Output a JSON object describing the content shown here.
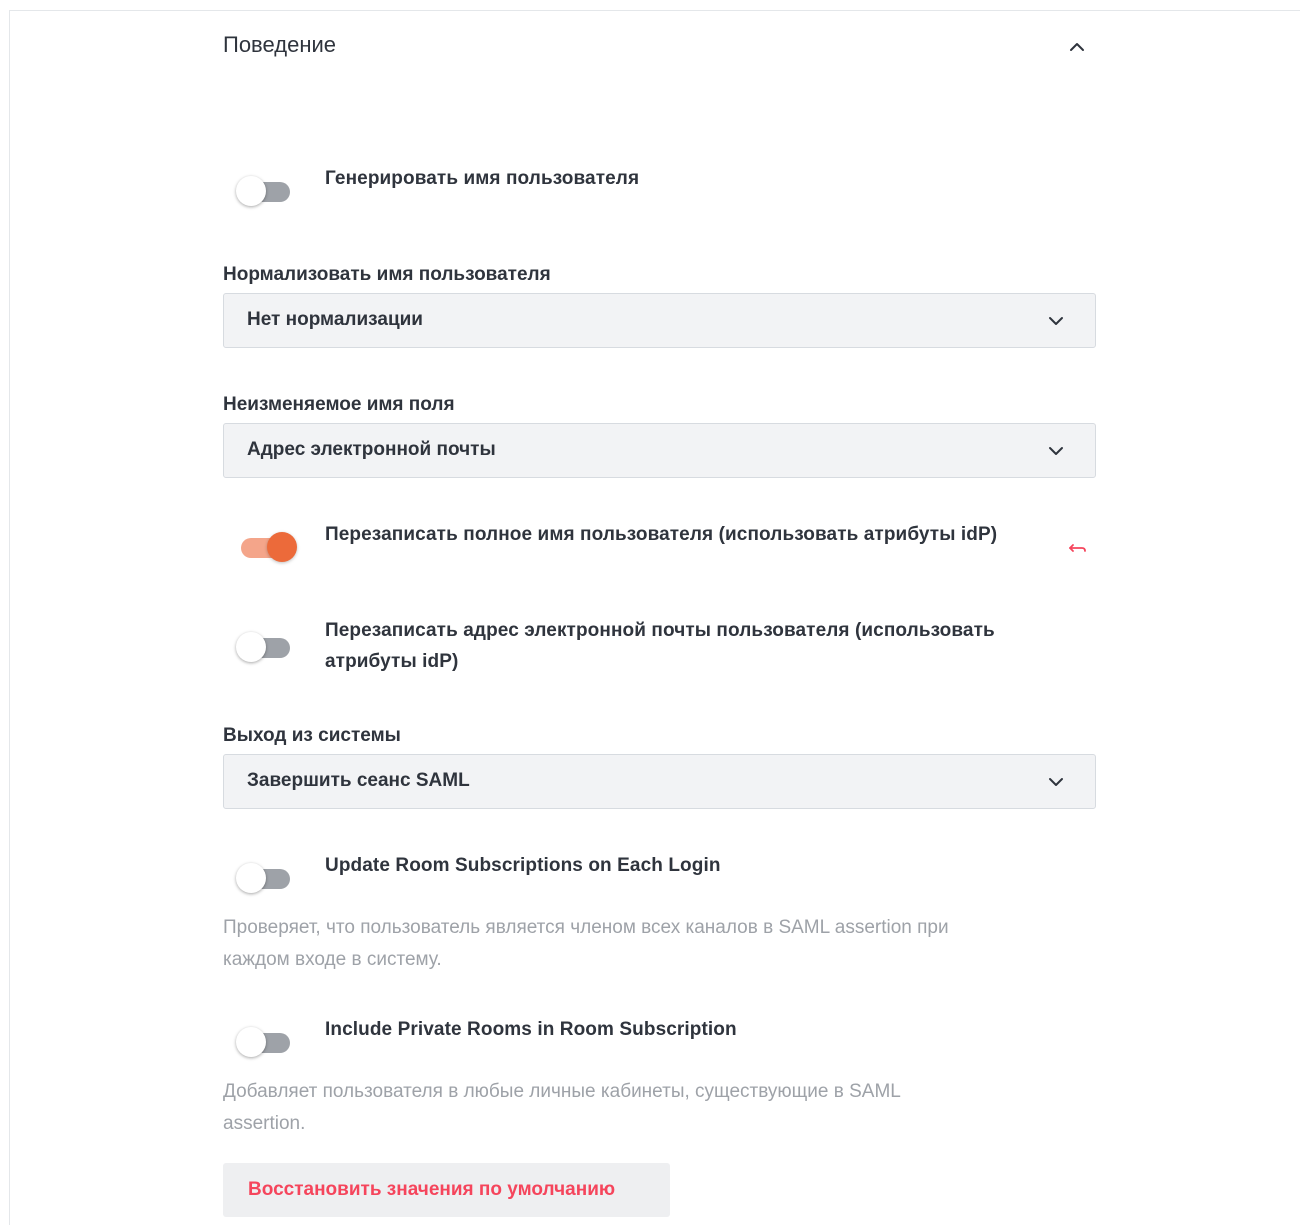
{
  "section": {
    "title": "Поведение"
  },
  "toggles": {
    "generate_username": {
      "label": "Генерировать имя пользователя",
      "on": false
    },
    "overwrite_fullname": {
      "label": "Перезаписать полное имя пользователя (использовать атрибуты idP)",
      "on": true
    },
    "overwrite_email_line1": "Перезаписать адрес электронной почты пользователя (использовать",
    "overwrite_email_line2": "атрибуты idP)",
    "update_rooms": {
      "label": "Update Room Subscriptions on Each Login",
      "on": false,
      "hint_line1": "Проверяет, что пользователь является членом всех каналов в SAML assertion при",
      "hint_line2": "каждом входе в систему."
    },
    "private_rooms": {
      "label": "Include Private Rooms in Room Subscription",
      "on": false,
      "hint_line1": "Добавляет пользователя в любые личные кабинеты, существующие в SAML",
      "hint_line2": "assertion."
    }
  },
  "selects": {
    "normalize": {
      "label": "Нормализовать имя пользователя",
      "value": "Нет нормализации"
    },
    "immutable": {
      "label": "Неизменяемое имя поля",
      "value": "Адрес электронной почты"
    },
    "logout": {
      "label": "Выход из системы",
      "value": "Завершить сеанс SAML"
    }
  },
  "reset_button": {
    "label": "Восстановить значения по умолчанию"
  },
  "colors": {
    "accent_toggle": "#ec6a3a",
    "accent_toggle_track": "#f4a58a",
    "danger_text": "#f5455c",
    "hint_text": "#9ea2a8",
    "select_bg": "#f2f3f5"
  },
  "icons": {
    "collapse": "chevron-up-icon",
    "dropdown": "chevron-down-icon",
    "reset": "undo-arrow-icon"
  }
}
